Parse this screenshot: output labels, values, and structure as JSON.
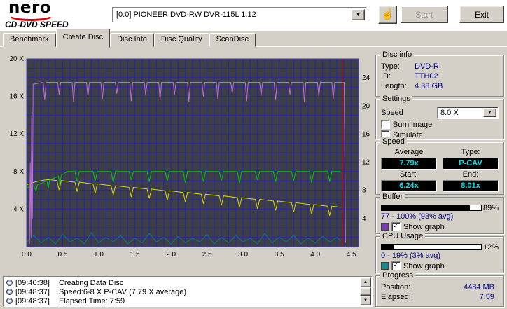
{
  "header": {
    "logo_line1": "nero",
    "logo_line2": "CD-DVD SPEED",
    "device": "[0:0]  PIONEER DVD-RW  DVR-115L 1.12",
    "start_label": "Start",
    "exit_label": "Exit"
  },
  "icons": {
    "dropdown": "▼",
    "up": "▲",
    "down": "▼",
    "check": "✓",
    "hand": "☝"
  },
  "tabs": [
    "Benchmark",
    "Create Disc",
    "Disc Info",
    "Disc Quality",
    "ScanDisc"
  ],
  "active_tab": "Create Disc",
  "disc_info": {
    "title": "Disc info",
    "type_label": "Type:",
    "type_value": "DVD-R",
    "id_label": "ID:",
    "id_value": "TTH02",
    "length_label": "Length:",
    "length_value": "4.38 GB"
  },
  "settings": {
    "title": "Settings",
    "speed_label": "Speed",
    "speed_value": "8.0 X",
    "burn_image_label": "Burn image",
    "burn_image_checked": false,
    "simulate_label": "Simulate",
    "simulate_checked": false
  },
  "speed": {
    "title": "Speed",
    "average_label": "Average",
    "type_label": "Type:",
    "average_value": "7.79x",
    "type_value": "P-CAV",
    "start_label": "Start:",
    "end_label": "End:",
    "start_value": "6.24x",
    "end_value": "8.01x"
  },
  "buffer": {
    "title": "Buffer",
    "value": 89,
    "percent": "89%",
    "range": "77 - 100% (93% avg)",
    "show_graph_label": "Show graph",
    "show_graph_checked": true,
    "color": "#7a3bb4"
  },
  "cpu": {
    "title": "CPU Usage",
    "value": 12,
    "percent": "12%",
    "range": "0 - 19% (3% avg)",
    "show_graph_label": "Show graph",
    "show_graph_checked": true,
    "color": "#1d8a8a"
  },
  "progress": {
    "title": "Progress",
    "position_label": "Position:",
    "position_value": "4484 MB",
    "elapsed_label": "Elapsed:",
    "elapsed_value": "7:59"
  },
  "log": {
    "lines": [
      {
        "time": "[09:40:38]",
        "text": "Creating Data Disc"
      },
      {
        "time": "[09:48:37]",
        "text": "Speed:6-8 X P-CAV (7.79 X average)"
      },
      {
        "time": "[09:48:37]",
        "text": "Elapsed Time: 7:59"
      }
    ]
  },
  "chart_data": {
    "type": "line",
    "x_unit": "GB",
    "x_max": 4.6,
    "x_ticks": [
      [
        0,
        "0.0"
      ],
      [
        0.5,
        "0.5"
      ],
      [
        1,
        "1.0"
      ],
      [
        1.5,
        "1.5"
      ],
      [
        2,
        "2.0"
      ],
      [
        2.5,
        "2.5"
      ],
      [
        3,
        "3.0"
      ],
      [
        3.5,
        "3.5"
      ],
      [
        4,
        "4.0"
      ],
      [
        4.5,
        "4.5"
      ]
    ],
    "y_left": {
      "max": 20,
      "ticks": [
        [
          4,
          "4 X"
        ],
        [
          8,
          "8 X"
        ],
        [
          12,
          "12 X"
        ],
        [
          16,
          "16 X"
        ],
        [
          20,
          "20 X"
        ]
      ]
    },
    "y_right": {
      "max": 26.7,
      "ticks": [
        [
          4,
          "4"
        ],
        [
          8,
          "8"
        ],
        [
          12,
          "12"
        ],
        [
          16,
          "16"
        ],
        [
          20,
          "20"
        ],
        [
          24,
          "24"
        ]
      ]
    },
    "grid": {
      "x_step": 0.1,
      "y_step": 1,
      "color": "#2626aa"
    },
    "bg": "#3e3e46",
    "border_color": "#3a3ac8",
    "end_marker": {
      "x": 4.38,
      "color": "#cc0000"
    },
    "series": [
      {
        "name": "cpu-usage",
        "color": "#0d7a7a",
        "points": [
          [
            0,
            0.5
          ],
          [
            0.1,
            1.2
          ],
          [
            0.2,
            0.4
          ],
          [
            0.3,
            1.0
          ],
          [
            0.4,
            0.3
          ],
          [
            0.5,
            1.3
          ],
          [
            0.6,
            0.5
          ],
          [
            0.7,
            0.9
          ],
          [
            0.8,
            0.3
          ],
          [
            0.9,
            1.5
          ],
          [
            1.0,
            0.4
          ],
          [
            1.1,
            1.0
          ],
          [
            1.2,
            0.5
          ],
          [
            1.3,
            1.2
          ],
          [
            1.4,
            0.3
          ],
          [
            1.5,
            0.9
          ],
          [
            1.6,
            0.4
          ],
          [
            1.7,
            1.4
          ],
          [
            1.8,
            0.5
          ],
          [
            1.9,
            1.0
          ],
          [
            2.0,
            0.3
          ],
          [
            2.1,
            1.1
          ],
          [
            2.2,
            0.4
          ],
          [
            2.3,
            0.9
          ],
          [
            2.4,
            0.5
          ],
          [
            2.5,
            1.3
          ],
          [
            2.6,
            0.3
          ],
          [
            2.7,
            1.0
          ],
          [
            2.8,
            0.4
          ],
          [
            2.9,
            1.2
          ],
          [
            3.0,
            0.5
          ],
          [
            3.1,
            0.9
          ],
          [
            3.2,
            0.3
          ],
          [
            3.3,
            1.4
          ],
          [
            3.4,
            0.4
          ],
          [
            3.5,
            1.0
          ],
          [
            3.6,
            0.5
          ],
          [
            3.7,
            1.2
          ],
          [
            3.8,
            0.3
          ],
          [
            3.9,
            0.9
          ],
          [
            4.0,
            0.4
          ],
          [
            4.1,
            1.1
          ],
          [
            4.2,
            0.5
          ],
          [
            4.3,
            1.0
          ],
          [
            4.35,
            0.6
          ]
        ]
      },
      {
        "name": "secondary-speed",
        "color": "#d8d800",
        "points": [
          [
            0,
            6.6
          ],
          [
            0.08,
            6.8
          ],
          [
            0.15,
            6.95
          ],
          [
            0.22,
            7.05
          ],
          [
            0.3,
            7.15
          ],
          [
            0.42,
            7.04
          ],
          [
            0.45,
            6.04
          ],
          [
            0.48,
            7.04
          ],
          [
            0.67,
            6.86
          ],
          [
            0.7,
            5.86
          ],
          [
            0.73,
            6.86
          ],
          [
            0.92,
            6.68
          ],
          [
            0.95,
            5.68
          ],
          [
            0.98,
            6.68
          ],
          [
            1.17,
            6.49
          ],
          [
            1.2,
            5.49
          ],
          [
            1.23,
            6.49
          ],
          [
            1.42,
            6.31
          ],
          [
            1.45,
            5.31
          ],
          [
            1.48,
            6.31
          ],
          [
            1.67,
            6.13
          ],
          [
            1.7,
            5.13
          ],
          [
            1.73,
            6.13
          ],
          [
            1.92,
            5.95
          ],
          [
            1.95,
            4.95
          ],
          [
            1.98,
            5.95
          ],
          [
            2.17,
            5.77
          ],
          [
            2.2,
            4.77
          ],
          [
            2.23,
            5.77
          ],
          [
            2.42,
            5.58
          ],
          [
            2.45,
            4.58
          ],
          [
            2.48,
            5.58
          ],
          [
            2.67,
            5.4
          ],
          [
            2.7,
            4.4
          ],
          [
            2.73,
            5.4
          ],
          [
            2.92,
            5.22
          ],
          [
            2.95,
            4.22
          ],
          [
            2.98,
            5.22
          ],
          [
            3.17,
            5.04
          ],
          [
            3.2,
            4.04
          ],
          [
            3.23,
            5.04
          ],
          [
            3.42,
            4.86
          ],
          [
            3.45,
            3.86
          ],
          [
            3.48,
            4.86
          ],
          [
            3.67,
            4.68
          ],
          [
            3.7,
            3.68
          ],
          [
            3.73,
            4.68
          ],
          [
            3.92,
            4.49
          ],
          [
            3.95,
            3.49
          ],
          [
            3.98,
            4.49
          ],
          [
            4.17,
            4.31
          ],
          [
            4.2,
            3.31
          ],
          [
            4.23,
            4.31
          ],
          [
            4.3,
            4.25
          ],
          [
            4.35,
            4.2
          ]
        ]
      },
      {
        "name": "write-speed",
        "color": "#00c800",
        "points": [
          [
            0,
            6.24
          ],
          [
            0.06,
            6.4
          ],
          [
            0.1,
            6.5
          ],
          [
            0.13,
            5.9
          ],
          [
            0.15,
            6.6
          ],
          [
            0.22,
            6.8
          ],
          [
            0.28,
            7.0
          ],
          [
            0.3,
            6.2
          ],
          [
            0.32,
            7.1
          ],
          [
            0.38,
            7.3
          ],
          [
            0.44,
            7.5
          ],
          [
            0.46,
            6.6
          ],
          [
            0.48,
            7.6
          ],
          [
            0.52,
            7.8
          ],
          [
            0.56,
            8.0
          ],
          [
            0.67,
            8.0
          ],
          [
            0.7,
            6.9
          ],
          [
            0.73,
            8.0
          ],
          [
            0.92,
            8.0
          ],
          [
            0.95,
            7.0
          ],
          [
            0.98,
            8.0
          ],
          [
            1.17,
            8.0
          ],
          [
            1.2,
            6.8
          ],
          [
            1.23,
            8.0
          ],
          [
            1.42,
            8.0
          ],
          [
            1.45,
            7.1
          ],
          [
            1.48,
            8.0
          ],
          [
            1.67,
            8.0
          ],
          [
            1.7,
            6.9
          ],
          [
            1.73,
            8.0
          ],
          [
            1.92,
            8.0
          ],
          [
            1.95,
            7.0
          ],
          [
            1.98,
            8.0
          ],
          [
            2.17,
            8.0
          ],
          [
            2.2,
            6.8
          ],
          [
            2.23,
            8.0
          ],
          [
            2.42,
            8.0
          ],
          [
            2.45,
            6.9
          ],
          [
            2.48,
            8.0
          ],
          [
            2.67,
            8.0
          ],
          [
            2.7,
            7.0
          ],
          [
            2.73,
            8.0
          ],
          [
            2.92,
            8.0
          ],
          [
            2.95,
            6.8
          ],
          [
            2.98,
            8.0
          ],
          [
            3.17,
            8.0
          ],
          [
            3.2,
            7.1
          ],
          [
            3.23,
            8.0
          ],
          [
            3.42,
            8.0
          ],
          [
            3.45,
            6.9
          ],
          [
            3.48,
            8.0
          ],
          [
            3.67,
            8.0
          ],
          [
            3.7,
            7.0
          ],
          [
            3.73,
            8.0
          ],
          [
            3.92,
            8.0
          ],
          [
            3.95,
            6.8
          ],
          [
            3.98,
            8.0
          ],
          [
            4.17,
            8.0
          ],
          [
            4.2,
            6.9
          ],
          [
            4.23,
            8.0
          ],
          [
            4.3,
            8.0
          ],
          [
            4.35,
            8.01
          ]
        ]
      },
      {
        "name": "buffer-level",
        "color": "#c06cd8",
        "points": [
          [
            0.04,
            0.3
          ],
          [
            0.05,
            9
          ],
          [
            0.06,
            1
          ],
          [
            0.07,
            14
          ],
          [
            0.08,
            3
          ],
          [
            0.09,
            17.3
          ],
          [
            0.23,
            17.5
          ],
          [
            0.25,
            15.6
          ],
          [
            0.27,
            17.5
          ],
          [
            0.43,
            17.5
          ],
          [
            0.45,
            16.2
          ],
          [
            0.47,
            17.5
          ],
          [
            0.63,
            17.5
          ],
          [
            0.65,
            15.4
          ],
          [
            0.67,
            17.5
          ],
          [
            0.83,
            17.5
          ],
          [
            0.85,
            16.0
          ],
          [
            0.87,
            17.5
          ],
          [
            1.03,
            17.5
          ],
          [
            1.05,
            15.7
          ],
          [
            1.07,
            17.5
          ],
          [
            1.23,
            17.5
          ],
          [
            1.25,
            16.3
          ],
          [
            1.27,
            17.5
          ],
          [
            1.43,
            17.5
          ],
          [
            1.45,
            15.5
          ],
          [
            1.47,
            17.5
          ],
          [
            1.63,
            17.5
          ],
          [
            1.65,
            16.1
          ],
          [
            1.67,
            17.5
          ],
          [
            1.83,
            17.5
          ],
          [
            1.85,
            15.6
          ],
          [
            1.87,
            17.5
          ],
          [
            2.03,
            17.5
          ],
          [
            2.05,
            16.2
          ],
          [
            2.07,
            17.5
          ],
          [
            2.23,
            17.5
          ],
          [
            2.25,
            15.4
          ],
          [
            2.27,
            17.5
          ],
          [
            2.43,
            17.5
          ],
          [
            2.45,
            16.0
          ],
          [
            2.47,
            17.5
          ],
          [
            2.63,
            17.5
          ],
          [
            2.65,
            15.7
          ],
          [
            2.67,
            17.5
          ],
          [
            2.83,
            17.5
          ],
          [
            2.85,
            16.3
          ],
          [
            2.87,
            17.5
          ],
          [
            3.03,
            17.5
          ],
          [
            3.05,
            15.5
          ],
          [
            3.07,
            17.5
          ],
          [
            3.23,
            17.5
          ],
          [
            3.25,
            16.1
          ],
          [
            3.27,
            17.5
          ],
          [
            3.43,
            17.5
          ],
          [
            3.45,
            15.6
          ],
          [
            3.47,
            17.5
          ],
          [
            3.63,
            17.5
          ],
          [
            3.65,
            16.2
          ],
          [
            3.67,
            17.5
          ],
          [
            3.83,
            17.5
          ],
          [
            3.85,
            15.4
          ],
          [
            3.87,
            17.5
          ],
          [
            4.03,
            17.5
          ],
          [
            4.05,
            16.0
          ],
          [
            4.07,
            17.5
          ],
          [
            4.23,
            17.5
          ],
          [
            4.25,
            15.7
          ],
          [
            4.27,
            17.5
          ],
          [
            4.4,
            17.5
          ],
          [
            4.42,
            0.4
          ]
        ]
      }
    ]
  }
}
